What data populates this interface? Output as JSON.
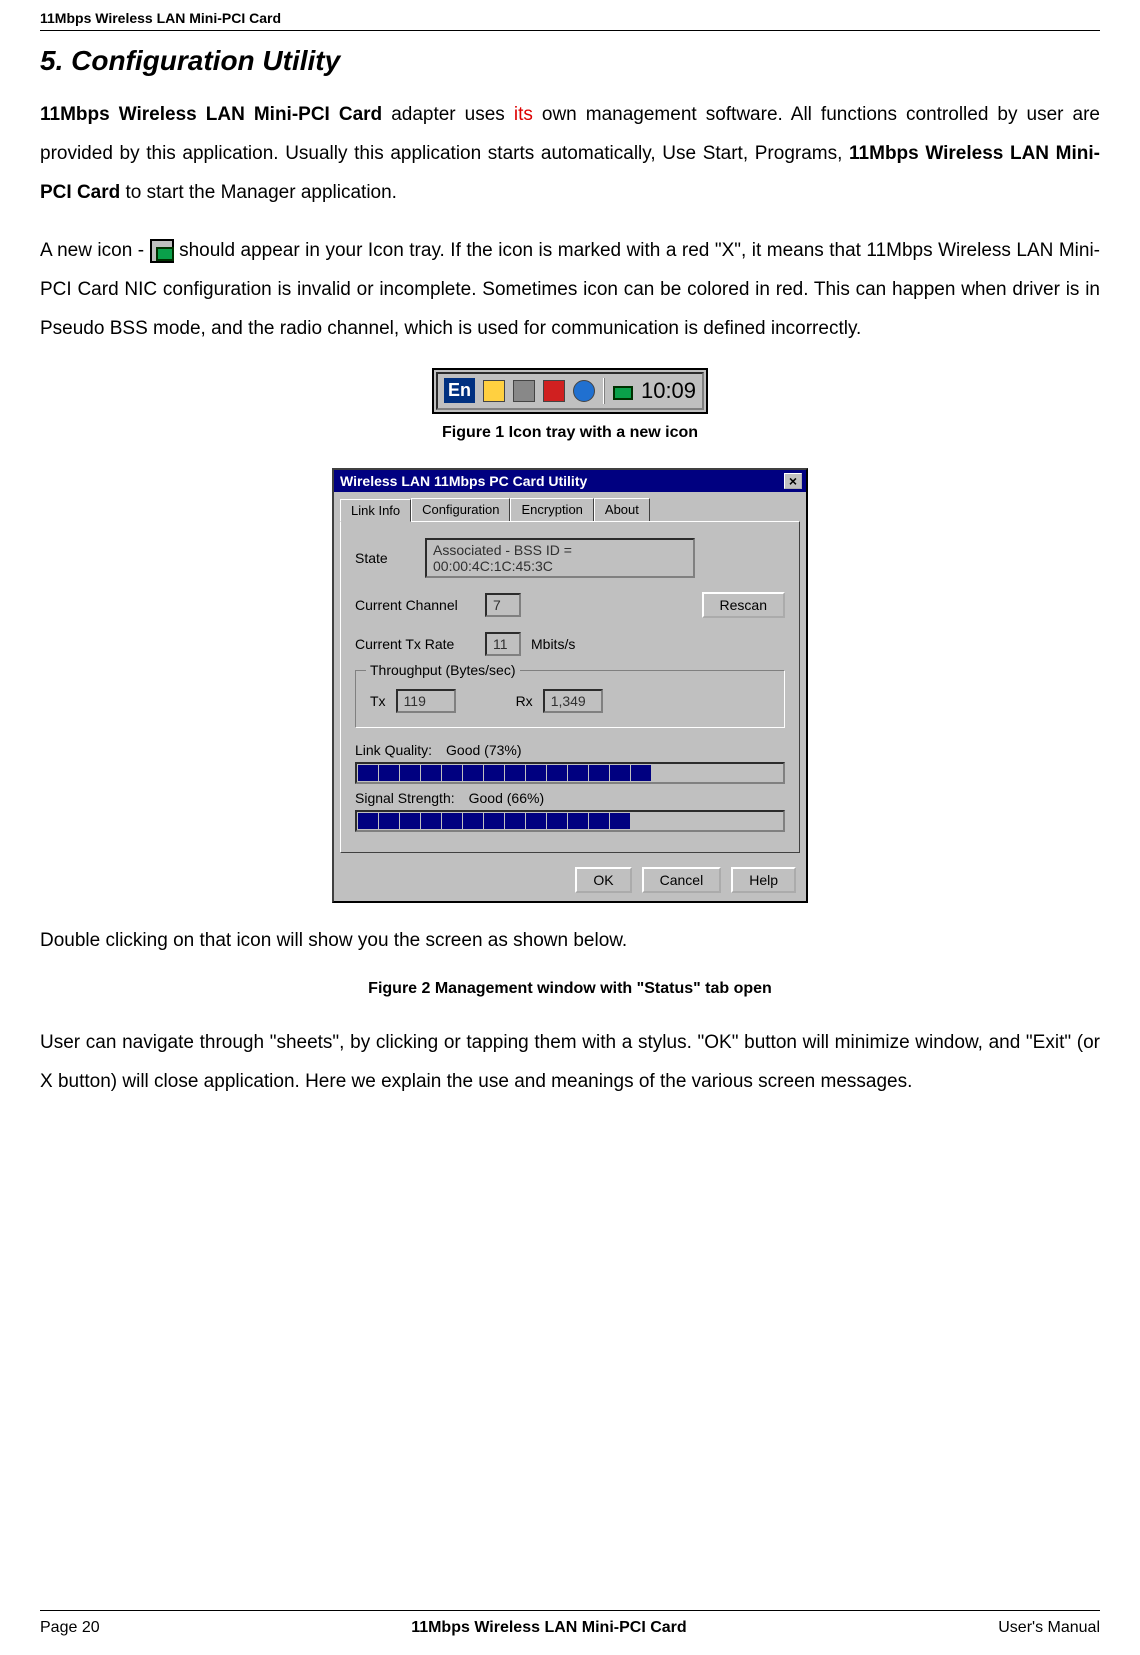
{
  "header_product": "11Mbps Wireless LAN Mini-PCI Card",
  "title": "5. Configuration Utility",
  "para1_prefix": "11Mbps Wireless LAN Mini-PCI Card",
  "para1_mid1": " adapter uses ",
  "para1_its": "its",
  "para1_mid2": " own management software. All functions controlled by user are provided by this application. Usually this application starts automatically, Use Start, Programs, ",
  "para1_bold2": "11Mbps Wireless LAN Mini-PCI Card",
  "para1_end": "  to start the Manager application.",
  "para2_a": "A new icon - ",
  "para2_b": " should appear in your Icon tray. If the icon is marked with a red \"X\", it means that 11Mbps Wireless LAN Mini-PCI Card NIC configuration is invalid or incomplete. Sometimes icon can be colored in red. This can happen when driver is in Pseudo BSS mode, and the radio channel, which is used for communication is defined incorrectly.",
  "tray": {
    "lang": "En",
    "time": "10:09"
  },
  "fig1_caption": "Figure 1 Icon tray with a new icon",
  "dialog": {
    "title": "Wireless LAN 11Mbps PC Card Utility",
    "tabs": {
      "t0": "Link Info",
      "t1": "Configuration",
      "t2": "Encryption",
      "t3": "About"
    },
    "state_label": "State",
    "state_value": "Associated - BSS ID = 00:00:4C:1C:45:3C",
    "chan_label": "Current Channel",
    "chan_value": "7",
    "rescan": "Rescan",
    "rate_label": "Current Tx Rate",
    "rate_value": "11",
    "rate_unit": "Mbits/s",
    "throughput_legend": "Throughput (Bytes/sec)",
    "tx_label": "Tx",
    "tx_value": "119",
    "rx_label": "Rx",
    "rx_value": "1,349",
    "lq_label": "Link Quality:",
    "lq_value": "Good (73%)",
    "ss_label": "Signal Strength:",
    "ss_value": "Good (66%)",
    "ok": "OK",
    "cancel": "Cancel",
    "help": "Help"
  },
  "after_dialog": " Double clicking on that icon will show you the screen as shown below.",
  "fig2_caption": "Figure 2 Management window with \"Status\" tab open",
  "para3": "User can navigate through \"sheets\", by clicking or tapping them with a stylus. \"OK\" button will minimize window, and \"Exit\" (or X button) will close application. Here we explain the use and meanings of the various screen messages.",
  "footer": {
    "page": "Page 20",
    "center": "11Mbps Wireless LAN Mini-PCI Card",
    "right": "User's Manual"
  },
  "chart_data": {
    "type": "bar",
    "series": [
      {
        "name": "Link Quality",
        "values": [
          73
        ],
        "label": "Good (73%)"
      },
      {
        "name": "Signal Strength",
        "values": [
          66
        ],
        "label": "Good (66%)"
      }
    ],
    "ylim": [
      0,
      100
    ]
  }
}
